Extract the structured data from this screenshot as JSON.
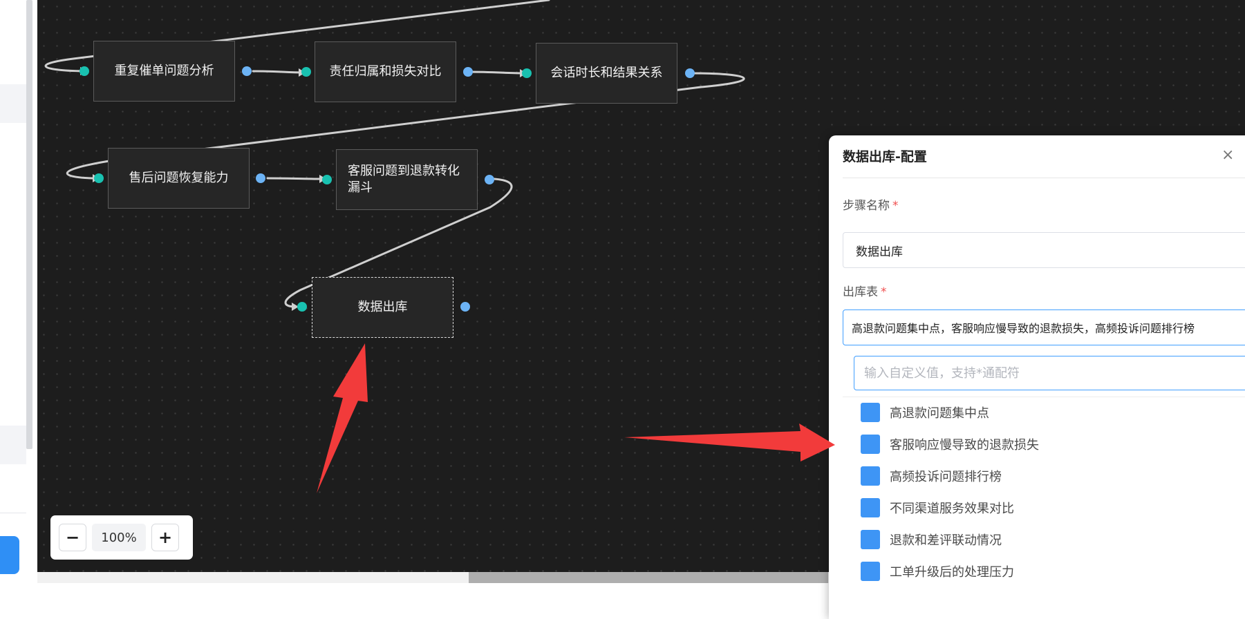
{
  "canvas": {
    "nodes": [
      {
        "id": "n1",
        "label": "重复催单问题分析"
      },
      {
        "id": "n2",
        "label": "责任归属和损失对比"
      },
      {
        "id": "n3",
        "label": "会话时长和结果关系"
      },
      {
        "id": "n4",
        "label": "售后问题恢复能力"
      },
      {
        "id": "n5",
        "label": "客服问题到退款转化漏斗"
      },
      {
        "id": "n6",
        "label": "数据出库"
      }
    ]
  },
  "zoom": {
    "minus": "−",
    "value": "100%",
    "plus": "+"
  },
  "panel": {
    "title": "数据出库-配置",
    "close": "×",
    "step_name_label": "步骤名称",
    "step_name_value": "数据出库",
    "table_label": "出库表",
    "table_value": "高退款问题集中点，客服响应慢导致的退款损失，高频投诉问题排行榜",
    "required_mark": "*",
    "search_placeholder": "输入自定义值，支持*通配符",
    "options": [
      {
        "label": "高退款问题集中点"
      },
      {
        "label": "客服响应慢导致的退款损失"
      },
      {
        "label": "高频投诉问题排行榜"
      },
      {
        "label": "不同渠道服务效果对比"
      },
      {
        "label": "退款和差评联动情况"
      },
      {
        "label": "工单升级后的处理压力"
      }
    ]
  },
  "colors": {
    "canvas_bg": "#1d1d1d",
    "node_bg": "#262626",
    "input_port": "#19c1b0",
    "output_port": "#6cb3f5",
    "checkbox": "#3e95f5",
    "focus_border": "#409eff",
    "annotation_arrow": "#f23b3b"
  }
}
